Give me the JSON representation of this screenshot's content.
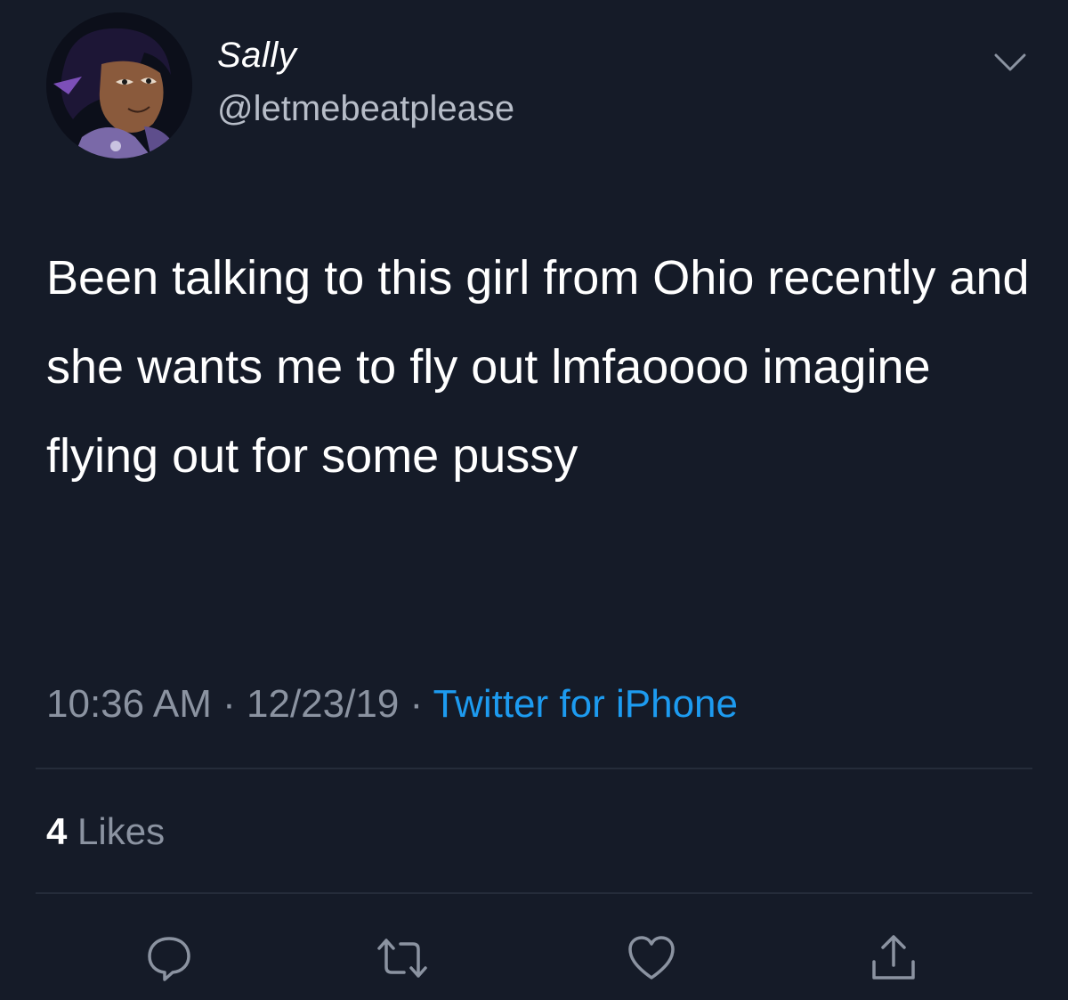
{
  "tweet": {
    "display_name": "Sally",
    "handle": "@letmebeatplease",
    "text": "Been talking to this girl from Ohio recently and she wants me to fly out lmfaoooo imagine flying out for some pussy",
    "time": "10:36 AM",
    "date": "12/23/19",
    "source": "Twitter for iPhone",
    "separator": " · ",
    "likes_count": "4",
    "likes_label": "Likes"
  },
  "icons": {
    "more": "chevron-down-icon",
    "reply": "reply-icon",
    "retweet": "retweet-icon",
    "like": "heart-icon",
    "share": "share-icon"
  },
  "colors": {
    "background": "#151b28",
    "link": "#1d9bf0",
    "secondary_text": "#8b93a1"
  }
}
